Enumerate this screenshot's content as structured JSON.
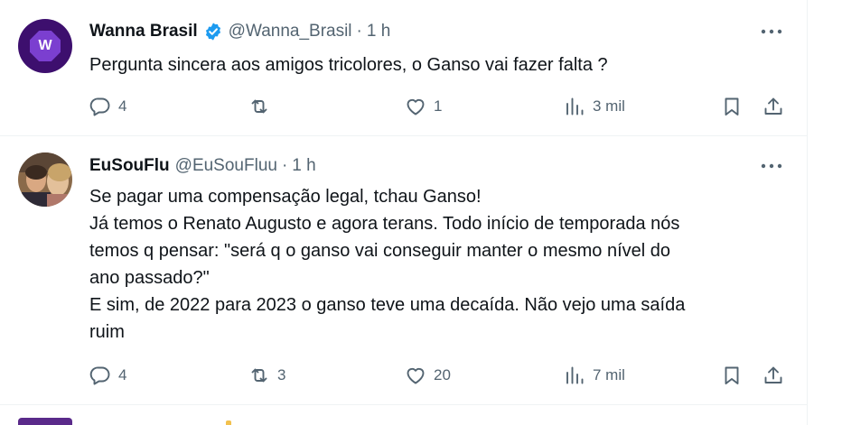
{
  "tweets": [
    {
      "author_name": "Wanna Brasil",
      "handle": "@Wanna_Brasil",
      "separator": "·",
      "time": "1 h",
      "verified": true,
      "avatar_letter": "W",
      "text": "Pergunta sincera aos amigos tricolores, o Ganso vai fazer falta ?",
      "replies": "4",
      "retweets": "",
      "likes": "1",
      "views": "3 mil"
    },
    {
      "author_name": "EuSouFlu",
      "handle": "@EuSouFluu",
      "separator": "·",
      "time": "1 h",
      "verified": false,
      "text": "Se pagar uma compensação legal, tchau Ganso!\nJá temos o Renato Augusto e agora terans. Todo início de temporada nós\ntemos q pensar: \"será q o ganso vai conseguir manter o mesmo nível do\nano passado?\"\nE sim, de 2022 para 2023 o ganso teve uma decaída. Não vejo uma saída\nruim",
      "replies": "4",
      "retweets": "3",
      "likes": "20",
      "views": "7 mil"
    }
  ],
  "colors": {
    "text_primary": "#0f1419",
    "text_secondary": "#536471",
    "verified_blue": "#1d9bf0",
    "divider": "#eff3f4",
    "wanna_avatar_bg": "#3d0f6e",
    "wanna_avatar_fg": "#7b3fd0"
  },
  "icons": {
    "reply": "speech-bubble",
    "retweet": "retweet-arrows",
    "like": "heart",
    "views": "bar-chart",
    "bookmark": "bookmark",
    "share": "upload-arrow",
    "more": "three-dots"
  }
}
